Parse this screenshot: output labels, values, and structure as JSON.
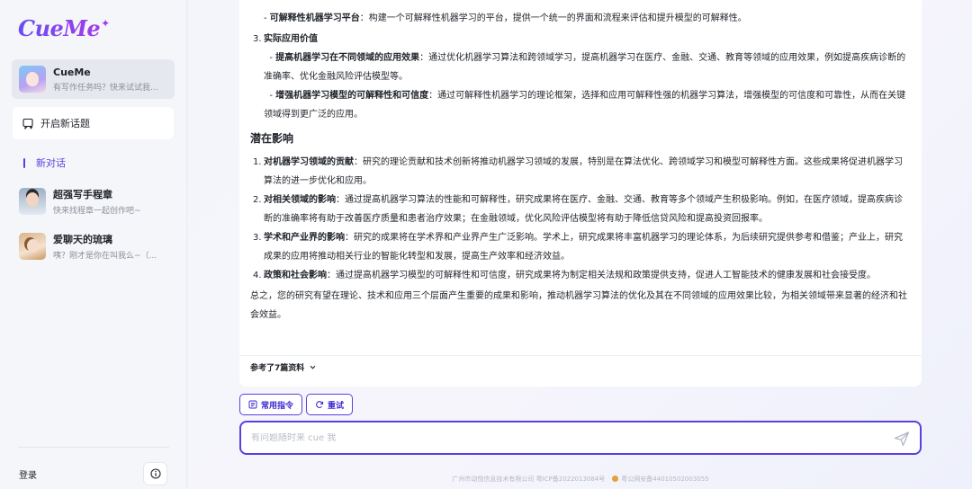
{
  "app": {
    "logo": "CueMe",
    "logo_star": "✦"
  },
  "sidebar": {
    "chats": [
      {
        "name": "CueMe",
        "subtitle": "有写作任务吗？快来试试我..."
      },
      {
        "name": "超强写手程章",
        "subtitle": "快来找程章一起创作吧~"
      },
      {
        "name": "爱聊天的琉璃",
        "subtitle": "咦？刚才是你在叫我么~（..."
      }
    ],
    "new_topic_label": "开启新话题",
    "new_chat_label": "新对话",
    "login_label": "登录",
    "info_icon": "info-icon"
  },
  "message": {
    "item_platform": {
      "bold": "可解释性机器学习平台",
      "text": "：构建一个可解释性机器学习的平台，提供一个统一的界面和流程来评估和提升模型的可解释性。"
    },
    "section3": {
      "num": "3.",
      "title": "实际应用价值"
    },
    "item_apply": {
      "bold": "提高机器学习在不同领域的应用效果",
      "text": "：通过优化机器学习算法和跨领域学习，提高机器学习在医疗、金融、交通、教育等领域的应用效果，例如提高疾病诊断的准确率、优化金融风险评估模型等。"
    },
    "item_trust": {
      "bold": "增强机器学习模型的可解释性和可信度",
      "text": "：通过可解释性机器学习的理论框架，选择和应用可解释性强的机器学习算法，增强模型的可信度和可靠性，从而在关键领域得到更广泛的应用。"
    },
    "impact_heading": "潜在影响",
    "impacts": [
      {
        "num": "1.",
        "bold": "对机器学习领域的贡献",
        "text": "：研究的理论贡献和技术创新将推动机器学习领域的发展，特别是在算法优化、跨领域学习和模型可解释性方面。这些成果将促进机器学习算法的进一步优化和应用。"
      },
      {
        "num": "2.",
        "bold": "对相关领域的影响",
        "text": "：通过提高机器学习算法的性能和可解释性，研究成果将在医疗、金融、交通、教育等多个领域产生积极影响。例如，在医疗领域，提高疾病诊断的准确率将有助于改善医疗质量和患者治疗效果；在金融领域，优化风险评估模型将有助于降低信贷风险和提高投资回报率。"
      },
      {
        "num": "3.",
        "bold": "学术和产业界的影响",
        "text": "：研究的成果将在学术界和产业界产生广泛影响。学术上，研究成果将丰富机器学习的理论体系，为后续研究提供参考和借鉴；产业上，研究成果的应用将推动相关行业的智能化转型和发展，提高生产效率和经济效益。"
      },
      {
        "num": "4.",
        "bold": "政策和社会影响",
        "text": "：通过提高机器学习模型的可解释性和可信度，研究成果将为制定相关法规和政策提供支持，促进人工智能技术的健康发展和社会接受度。"
      }
    ],
    "summary": "总之，您的研究有望在理论、技术和应用三个层面产生重要的成果和影响，推动机器学习算法的优化及其在不同领域的应用效果比较，为相关领域带来显著的经济和社会效益。",
    "refs_label": "参考了7篇资料",
    "dash": "-"
  },
  "actions": {
    "common_cmd_label": "常用指令",
    "retry_label": "重试"
  },
  "input": {
    "placeholder": "有问题随时来 cue 我",
    "value": ""
  },
  "footer": {
    "company": "广州市动悦信息技术有限公司 粤ICP备2022013084号",
    "police": "粤公网安备44010502003055"
  },
  "colors": {
    "accent": "#5b3fe0",
    "sidebar_bg": "#f5f6f9",
    "main_bg": "#f4f5fb"
  }
}
